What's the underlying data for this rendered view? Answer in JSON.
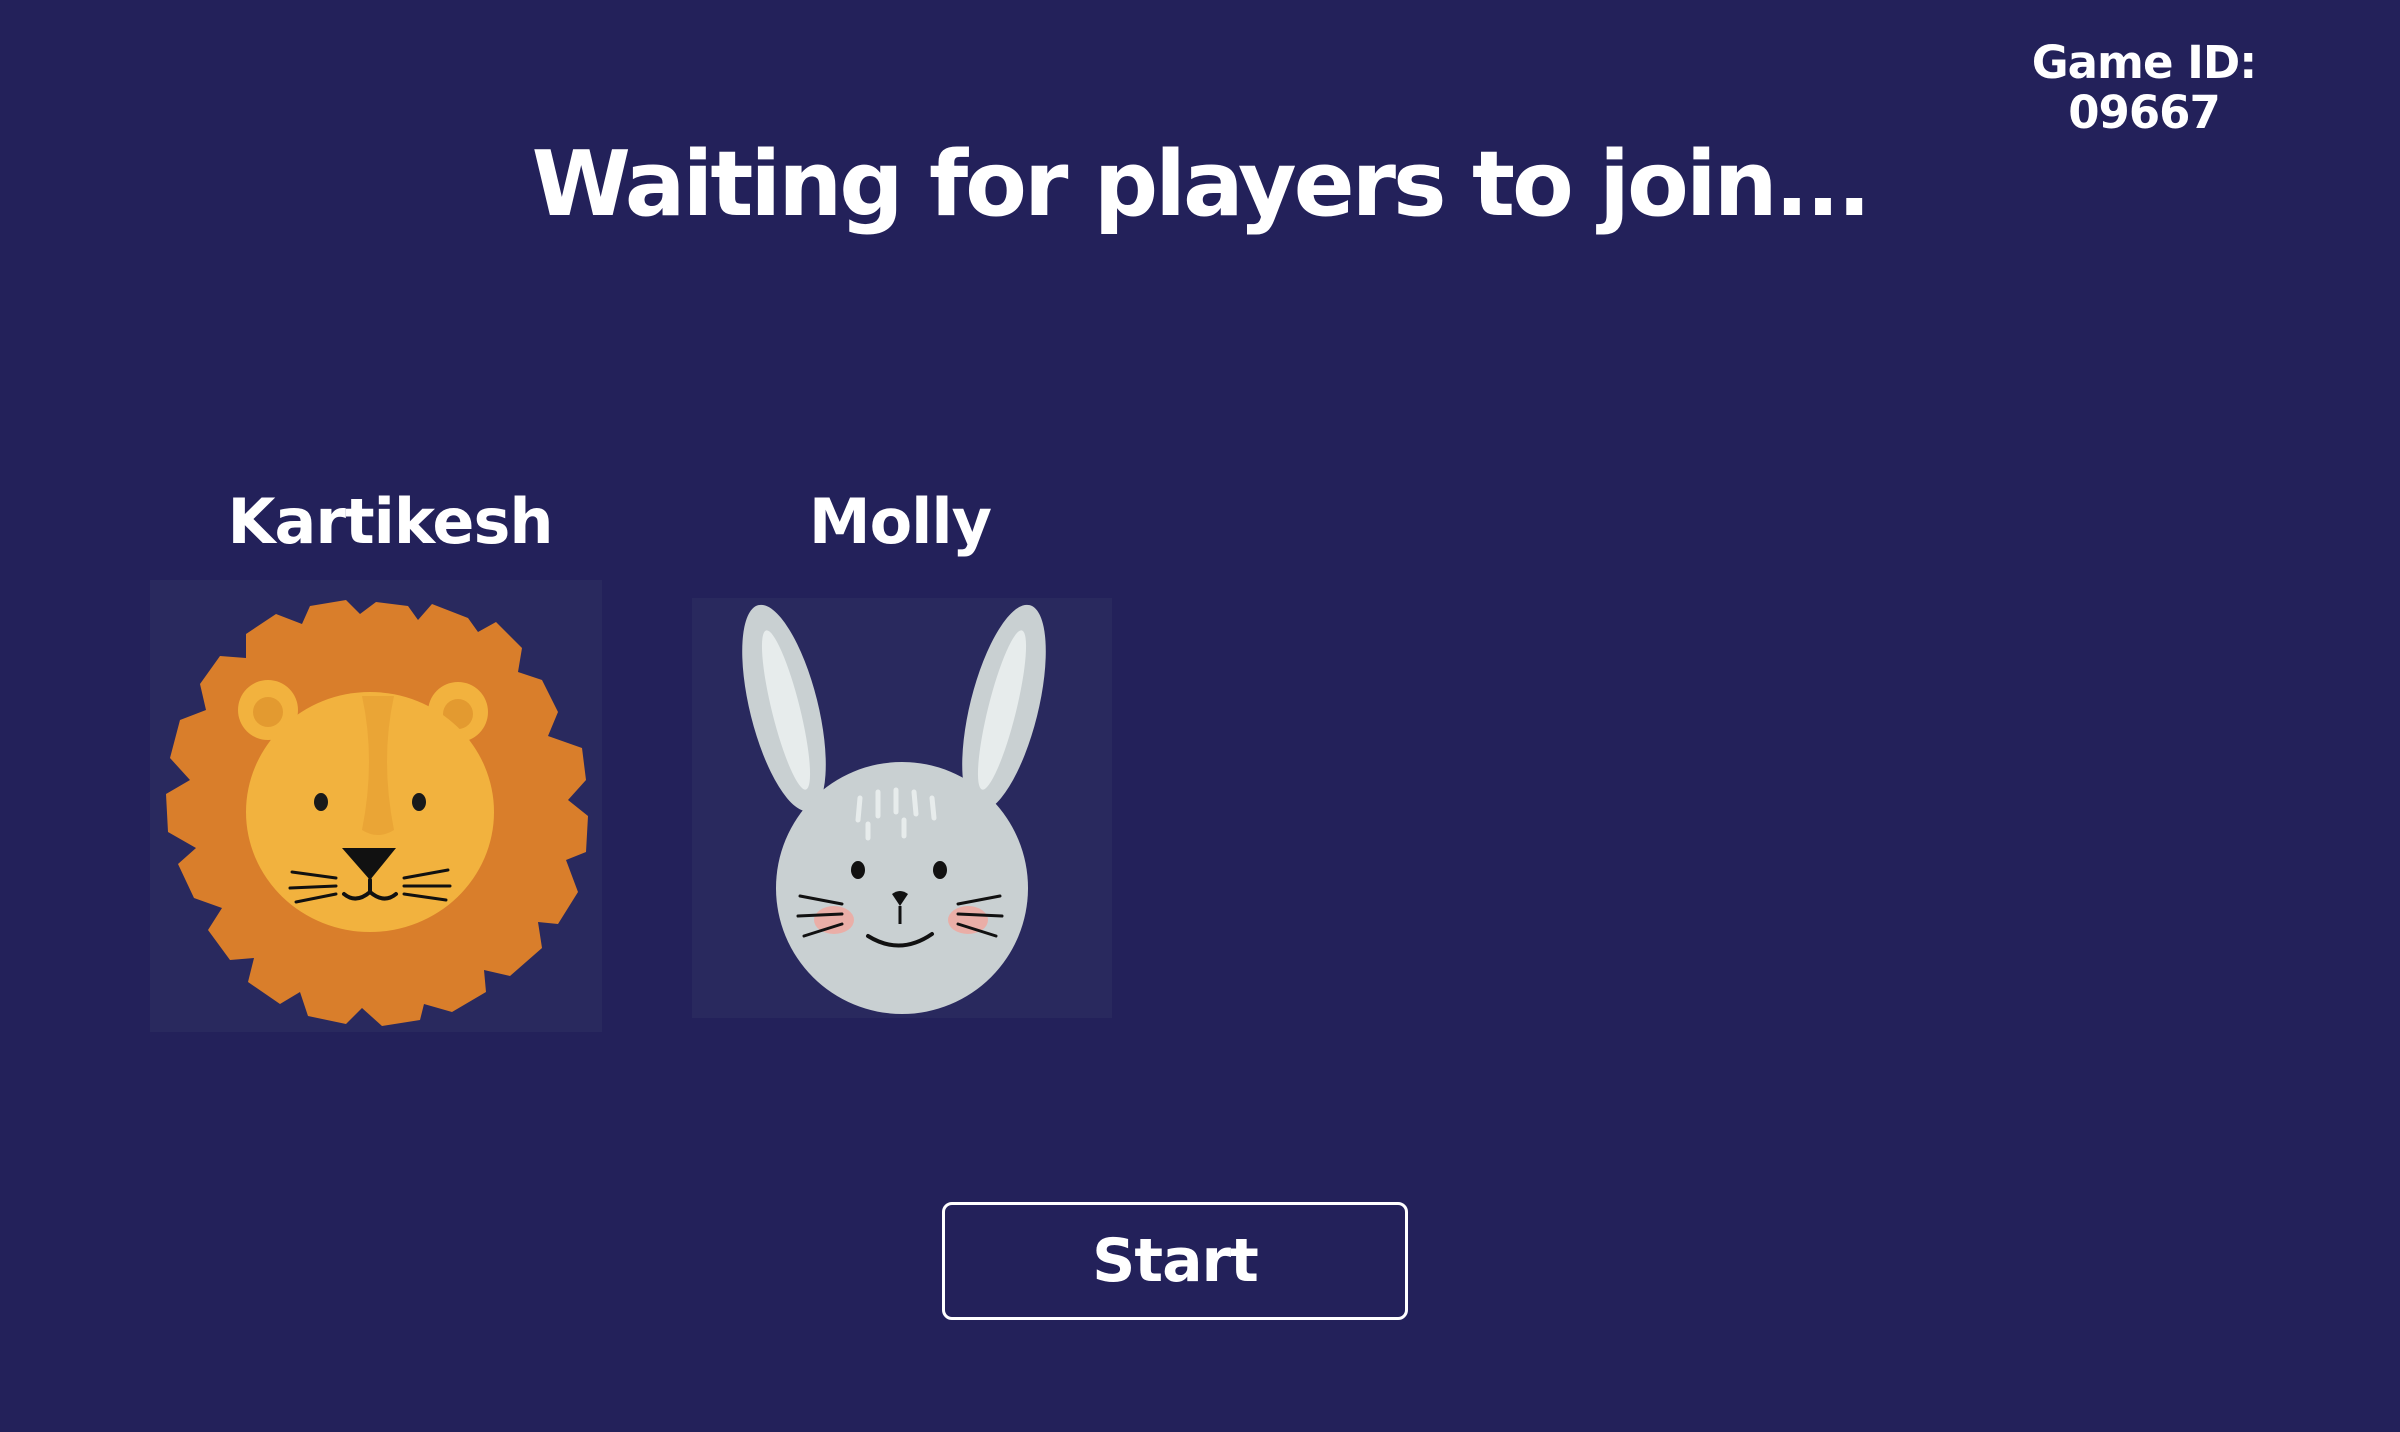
{
  "header": {
    "game_id_label": "Game ID:",
    "game_id_value": "09667"
  },
  "main": {
    "title": "Waiting for players to join..."
  },
  "players": [
    {
      "name": "Kartikesh",
      "avatar": "lion-icon"
    },
    {
      "name": "Molly",
      "avatar": "bunny-icon"
    }
  ],
  "actions": {
    "start_label": "Start"
  },
  "colors": {
    "background": "#23215a",
    "text": "#ffffff",
    "avatar_tile": "#29295e",
    "lion_mane": "#d97e2b",
    "lion_face": "#f2b23e",
    "bunny_fur": "#c9d0d2",
    "bunny_cheek": "#f0a8a0"
  }
}
